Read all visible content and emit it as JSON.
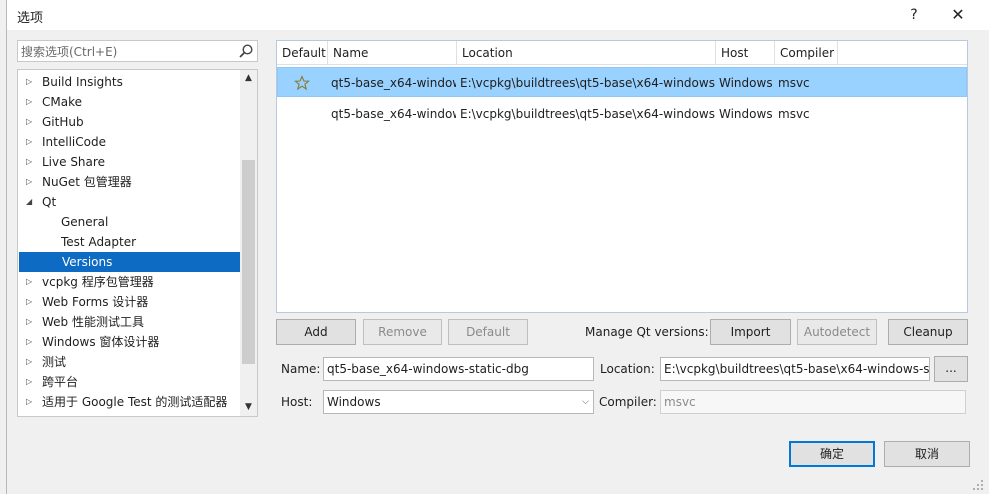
{
  "window": {
    "title": "选项",
    "help_label": "?",
    "close_label": "✕"
  },
  "search": {
    "placeholder": "搜索选项(Ctrl+E)"
  },
  "tree": {
    "items": [
      {
        "label": "Build Insights",
        "arrow": "▷",
        "level": 0
      },
      {
        "label": "CMake",
        "arrow": "▷",
        "level": 0
      },
      {
        "label": "GitHub",
        "arrow": "▷",
        "level": 0
      },
      {
        "label": "IntelliCode",
        "arrow": "▷",
        "level": 0
      },
      {
        "label": "Live Share",
        "arrow": "▷",
        "level": 0
      },
      {
        "label": "NuGet 包管理器",
        "arrow": "▷",
        "level": 0
      },
      {
        "label": "Qt",
        "arrow": "◢",
        "level": 0
      },
      {
        "label": "General",
        "arrow": "",
        "level": 1
      },
      {
        "label": "Test Adapter",
        "arrow": "",
        "level": 1
      },
      {
        "label": "Versions",
        "arrow": "",
        "level": 1,
        "selected": true
      },
      {
        "label": "vcpkg 程序包管理器",
        "arrow": "▷",
        "level": 0
      },
      {
        "label": "Web Forms 设计器",
        "arrow": "▷",
        "level": 0
      },
      {
        "label": "Web 性能测试工具",
        "arrow": "▷",
        "level": 0
      },
      {
        "label": "Windows 窗体设计器",
        "arrow": "▷",
        "level": 0
      },
      {
        "label": "测试",
        "arrow": "▷",
        "level": 0
      },
      {
        "label": "跨平台",
        "arrow": "▷",
        "level": 0
      },
      {
        "label": "适用于 Google Test 的测试适配器",
        "arrow": "▷",
        "level": 0
      }
    ]
  },
  "table": {
    "headers": {
      "default": "Default",
      "name": "Name",
      "location": "Location",
      "host": "Host",
      "compiler": "Compiler"
    },
    "rows": [
      {
        "name": "qt5-base_x64-window",
        "location": "E:\\vcpkg\\buildtrees\\qt5-base\\x64-windows-",
        "host": "Windows",
        "compiler": "msvc",
        "is_default": true
      },
      {
        "name": "qt5-base_x64-window",
        "location": "E:\\vcpkg\\buildtrees\\qt5-base\\x64-windows-",
        "host": "Windows",
        "compiler": "msvc",
        "is_default": false
      }
    ]
  },
  "actions": {
    "add": "Add",
    "remove": "Remove",
    "default": "Default",
    "manage_label": "Manage Qt versions:",
    "import": "Import",
    "autodetect": "Autodetect",
    "cleanup": "Cleanup"
  },
  "details": {
    "name_label": "Name:",
    "name_value": "qt5-base_x64-windows-static-dbg",
    "location_label": "Location:",
    "location_value": "E:\\vcpkg\\buildtrees\\qt5-base\\x64-windows-st",
    "browse_label": "...",
    "host_label": "Host:",
    "host_value": "Windows",
    "compiler_label": "Compiler:",
    "compiler_value": "msvc"
  },
  "footer": {
    "ok": "确定",
    "cancel": "取消"
  },
  "colors": {
    "selection": "#0e6bc4",
    "row_selected": "#99d1ff",
    "primary_border": "#0078d7"
  }
}
